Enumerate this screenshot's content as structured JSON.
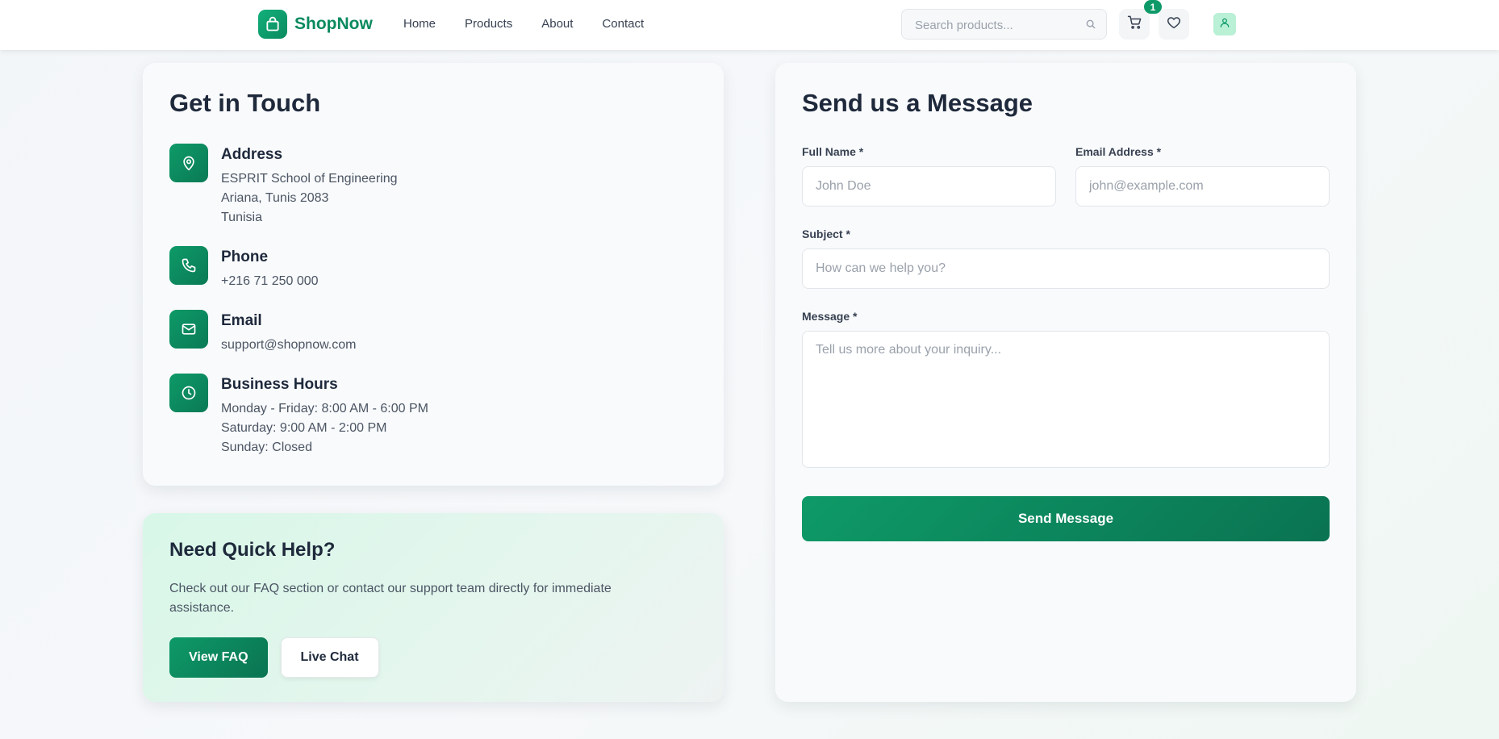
{
  "header": {
    "brand": "ShopNow",
    "nav": [
      "Home",
      "Products",
      "About",
      "Contact"
    ],
    "search_placeholder": "Search products...",
    "cart_count": "1",
    "accent": "#0e9a68"
  },
  "contact": {
    "title": "Get in Touch",
    "items": [
      {
        "icon": "map-pin-icon",
        "title": "Address",
        "lines": [
          "ESPRIT School of Engineering",
          "Ariana, Tunis 2083",
          "Tunisia"
        ]
      },
      {
        "icon": "phone-icon",
        "title": "Phone",
        "lines": [
          "+216 71 250 000"
        ]
      },
      {
        "icon": "mail-icon",
        "title": "Email",
        "lines": [
          "support@shopnow.com"
        ]
      },
      {
        "icon": "clock-icon",
        "title": "Business Hours",
        "lines": [
          "Monday - Friday: 8:00 AM - 6:00 PM",
          "Saturday: 9:00 AM - 2:00 PM",
          "Sunday: Closed"
        ]
      }
    ]
  },
  "help": {
    "title": "Need Quick Help?",
    "text": "Check out our FAQ section or contact our support team directly for immediate assistance.",
    "faq_label": "View FAQ",
    "chat_label": "Live Chat"
  },
  "form": {
    "title": "Send us a Message",
    "name_label": "Full Name *",
    "name_placeholder": "John Doe",
    "email_label": "Email Address *",
    "email_placeholder": "john@example.com",
    "subject_label": "Subject *",
    "subject_placeholder": "How can we help you?",
    "message_label": "Message *",
    "message_placeholder": "Tell us more about your inquiry...",
    "submit_label": "Send Message"
  }
}
